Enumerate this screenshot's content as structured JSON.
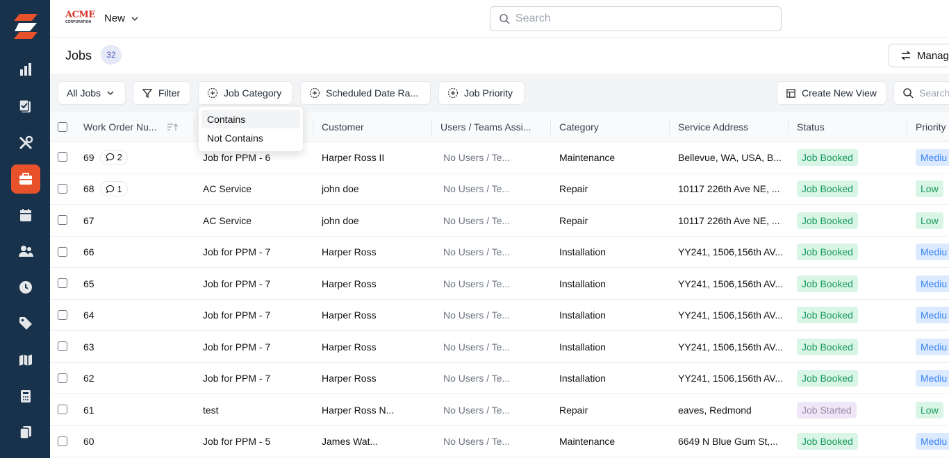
{
  "topbar": {
    "brand": "ACME",
    "brand_sub": "CORPORATION",
    "new_label": "New",
    "search_placeholder": "Search"
  },
  "header": {
    "title": "Jobs",
    "count": "32",
    "manage_label": "Manage"
  },
  "filters": {
    "all_jobs": "All Jobs",
    "filter": "Filter",
    "job_category": "Job Category",
    "scheduled_date": "Scheduled Date Ra...",
    "job_priority": "Job Priority",
    "create_view": "Create New View",
    "search_placeholder": "Search"
  },
  "dropdown": {
    "items": [
      "Contains",
      "Not Contains"
    ]
  },
  "table": {
    "columns": [
      "Work Order Nu...",
      "Customer",
      "Users / Teams Assi...",
      "Category",
      "Service Address",
      "Status",
      "Priority"
    ],
    "rows": [
      {
        "wo": "69",
        "comments": "2",
        "title": "Job for PPM - 6",
        "customer": "Harper Ross II",
        "users": "No Users / Te...",
        "category": "Maintenance",
        "address": "Bellevue, WA, USA, B...",
        "status": "Job Booked",
        "priority": "Mediu"
      },
      {
        "wo": "68",
        "comments": "1",
        "title": "AC Service",
        "customer": "john doe",
        "users": "No Users / Te...",
        "category": "Repair",
        "address": "10117 226th Ave NE, ...",
        "status": "Job Booked",
        "priority": "Low"
      },
      {
        "wo": "67",
        "comments": "",
        "title": "AC Service",
        "customer": "john doe",
        "users": "No Users / Te...",
        "category": "Repair",
        "address": "10117 226th Ave NE, ...",
        "status": "Job Booked",
        "priority": "Low"
      },
      {
        "wo": "66",
        "comments": "",
        "title": "Job for PPM - 7",
        "customer": "Harper Ross",
        "users": "No Users / Te...",
        "category": "Installation",
        "address": "YY241, 1506,156th AV...",
        "status": "Job Booked",
        "priority": "Mediu"
      },
      {
        "wo": "65",
        "comments": "",
        "title": "Job for PPM - 7",
        "customer": "Harper Ross",
        "users": "No Users / Te...",
        "category": "Installation",
        "address": "YY241, 1506,156th AV...",
        "status": "Job Booked",
        "priority": "Mediu"
      },
      {
        "wo": "64",
        "comments": "",
        "title": "Job for PPM - 7",
        "customer": "Harper Ross",
        "users": "No Users / Te...",
        "category": "Installation",
        "address": "YY241, 1506,156th AV...",
        "status": "Job Booked",
        "priority": "Mediu"
      },
      {
        "wo": "63",
        "comments": "",
        "title": "Job for PPM - 7",
        "customer": "Harper Ross",
        "users": "No Users / Te...",
        "category": "Installation",
        "address": "YY241, 1506,156th AV...",
        "status": "Job Booked",
        "priority": "Mediu"
      },
      {
        "wo": "62",
        "comments": "",
        "title": "Job for PPM - 7",
        "customer": "Harper Ross",
        "users": "No Users / Te...",
        "category": "Installation",
        "address": "YY241, 1506,156th AV...",
        "status": "Job Booked",
        "priority": "Mediu"
      },
      {
        "wo": "61",
        "comments": "",
        "title": "test",
        "customer": "Harper Ross N...",
        "users": "No Users / Te...",
        "category": "Repair",
        "address": "eaves, Redmond",
        "status": "Job Started",
        "priority": "Low"
      },
      {
        "wo": "60",
        "comments": "",
        "title": "Job for PPM - 5",
        "customer": "James Wat...",
        "users": "No Users / Te...",
        "category": "Maintenance",
        "address": "6649 N Blue Gum St,...",
        "status": "Job Booked",
        "priority": "Mediu"
      }
    ]
  },
  "sidebar": {
    "items": [
      "dashboard-icon",
      "clipboard-icon",
      "tools-icon",
      "briefcase-icon",
      "calendar-icon",
      "users-icon",
      "clock-icon",
      "tag-icon",
      "map-icon",
      "calculator-icon",
      "files-icon"
    ]
  },
  "colors": {
    "sidebar_bg": "#17324a",
    "accent": "#e8522b",
    "booked_bg": "#d9f5e6",
    "booked_fg": "#169a5a"
  }
}
